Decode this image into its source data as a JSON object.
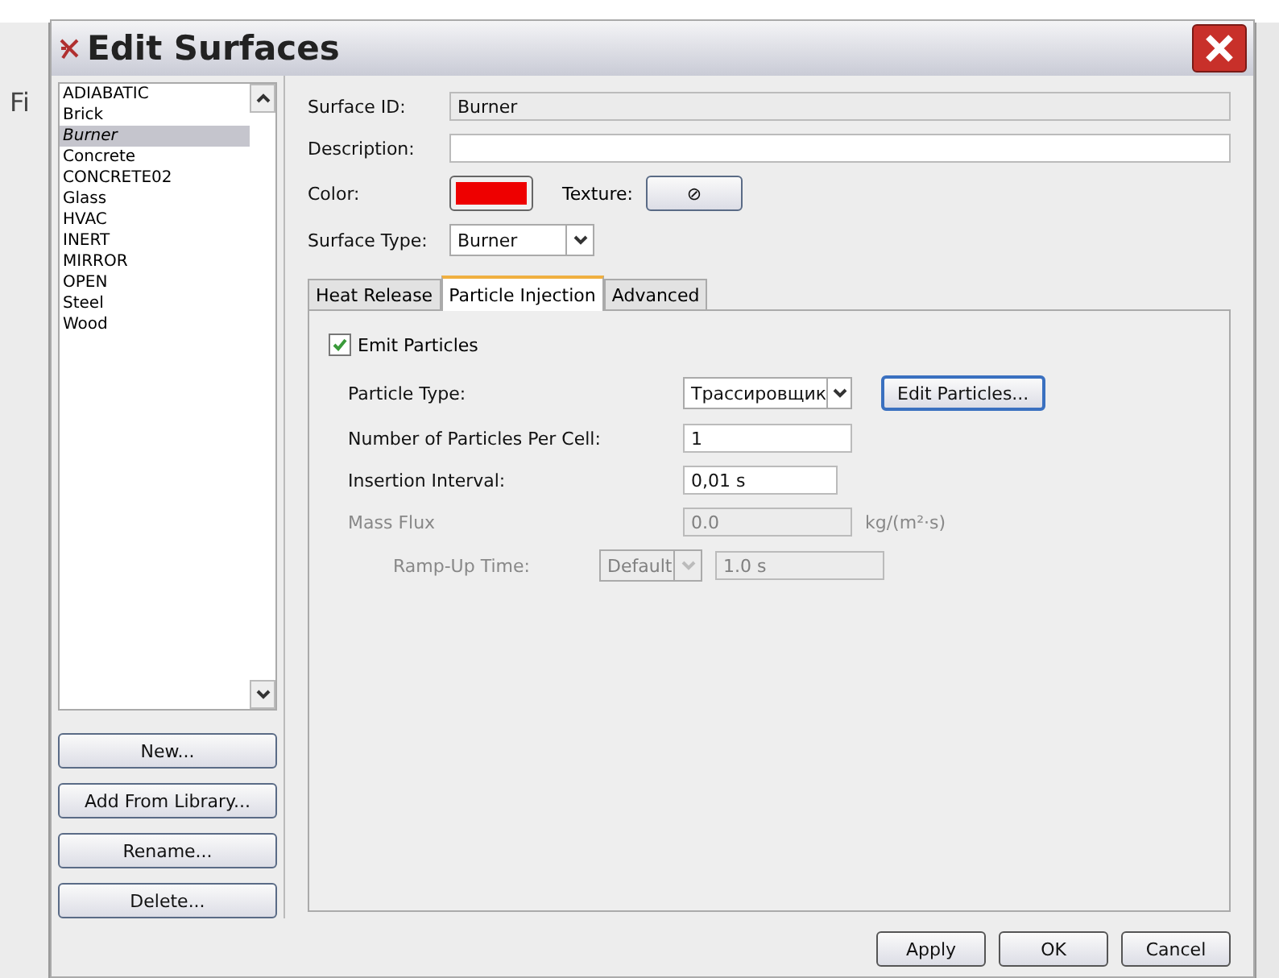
{
  "background_app": {
    "menu_text": "Fi"
  },
  "window": {
    "title": "Edit Surfaces"
  },
  "surfaces": [
    {
      "label": "ADIABATIC",
      "selected": false
    },
    {
      "label": "Brick",
      "selected": false
    },
    {
      "label": "Burner",
      "selected": true
    },
    {
      "label": "Concrete",
      "selected": false
    },
    {
      "label": "CONCRETE02",
      "selected": false
    },
    {
      "label": "Glass",
      "selected": false
    },
    {
      "label": "HVAC",
      "selected": false
    },
    {
      "label": "INERT",
      "selected": false
    },
    {
      "label": "MIRROR",
      "selected": false
    },
    {
      "label": "OPEN",
      "selected": false
    },
    {
      "label": "Steel",
      "selected": false
    },
    {
      "label": "Wood",
      "selected": false
    }
  ],
  "list_buttons": [
    "New...",
    "Add From Library...",
    "Rename...",
    "Delete..."
  ],
  "surface_id": {
    "label": "Surface ID:",
    "value": "Burner"
  },
  "description": {
    "label": "Description:"
  },
  "color": {
    "label": "Color:",
    "color": "#ee0000"
  },
  "texture": {
    "label": "Texture:",
    "button": "⊘"
  },
  "surface_type": {
    "label": "Surface Type:",
    "value": "Burner"
  },
  "tabs": [
    {
      "label": "Heat Release",
      "selected": false
    },
    {
      "label": "Particle Injection",
      "selected": true
    },
    {
      "label": "Advanced",
      "selected": false
    }
  ],
  "emit_particles": {
    "label": "Emit Particles",
    "checked": true
  },
  "rows": [
    {
      "kind": "select",
      "label": "Particle Type:",
      "value": "Трассировщик",
      "button": "Edit Particles...",
      "disabled": false
    },
    {
      "kind": "input",
      "label": "Number of Particles Per Cell:",
      "value": "1",
      "disabled": false
    },
    {
      "kind": "input",
      "label": "Insertion Interval:",
      "value": "0,01 s",
      "disabled": false
    },
    {
      "kind": "input",
      "label": "Mass Flux",
      "value": "0.0",
      "unit": "kg/(m²·s)",
      "disabled": true
    },
    {
      "kind": "ramp",
      "label": "Ramp-Up Time:",
      "option": "Default",
      "value": "1.0 s",
      "disabled": true
    }
  ],
  "footer_buttons": [
    "Apply",
    "OK",
    "Cancel"
  ]
}
